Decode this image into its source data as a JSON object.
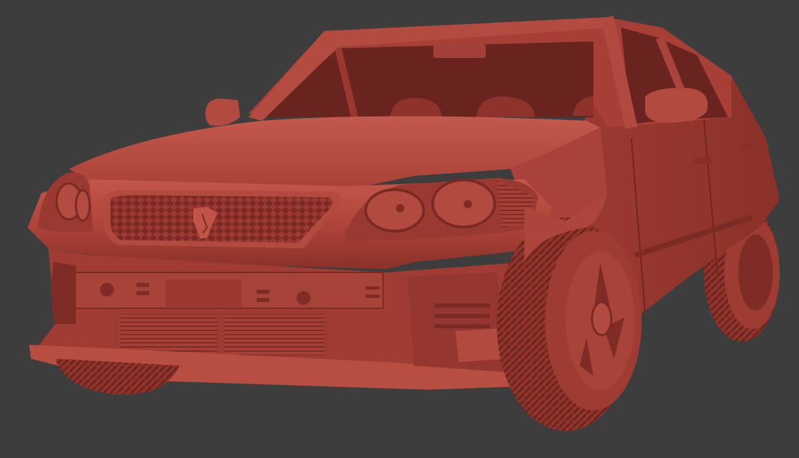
{
  "scene": {
    "subject": "car-model-render",
    "colors": {
      "background": "#3d3d3d",
      "body": "#b0443a",
      "body_light": "#c9574b",
      "body_dark": "#7d2a24",
      "shadow": "#5a1c18",
      "glass": "#6a2420"
    }
  }
}
